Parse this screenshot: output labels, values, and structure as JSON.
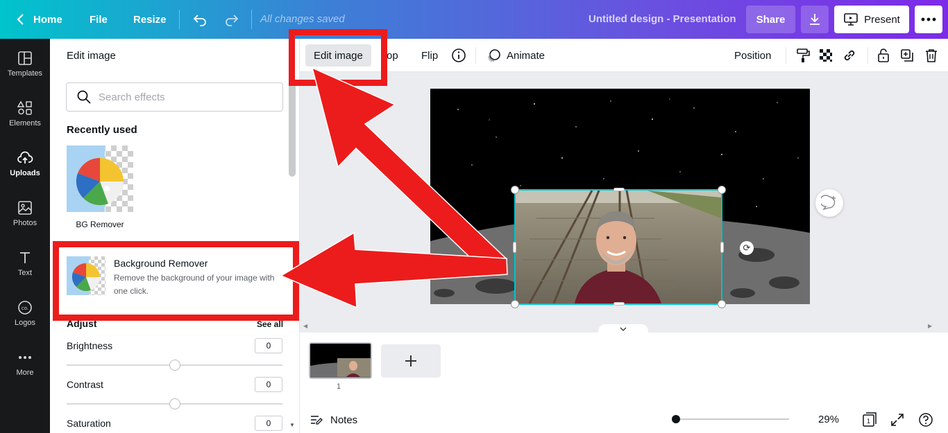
{
  "topbar": {
    "home": "Home",
    "file": "File",
    "resize": "Resize",
    "saved_status": "All changes saved",
    "doc_title": "Untitled design - Presentation",
    "share": "Share",
    "present": "Present"
  },
  "rail": {
    "items": [
      {
        "label": "Templates",
        "icon": "templates-icon"
      },
      {
        "label": "Elements",
        "icon": "elements-icon"
      },
      {
        "label": "Uploads",
        "icon": "uploads-icon"
      },
      {
        "label": "Photos",
        "icon": "photos-icon"
      },
      {
        "label": "Text",
        "icon": "text-icon"
      },
      {
        "label": "Logos",
        "icon": "logos-icon"
      },
      {
        "label": "More",
        "icon": "more-icon"
      }
    ]
  },
  "panel": {
    "title": "Edit image",
    "search_placeholder": "Search effects",
    "recently_used": "Recently used",
    "recent_item": "BG Remover",
    "effect_name": "Background Remover",
    "effect_desc": "Remove the background of your image with one click.",
    "adjust": "Adjust",
    "see_all": "See all",
    "sliders": [
      {
        "label": "Brightness",
        "value": "0"
      },
      {
        "label": "Contrast",
        "value": "0"
      },
      {
        "label": "Saturation",
        "value": "0"
      }
    ]
  },
  "ctxbar": {
    "edit_image": "Edit image",
    "crop": "rop",
    "flip": "Flip",
    "animate": "Animate",
    "position": "Position"
  },
  "pages": {
    "page_number": "1"
  },
  "footer": {
    "notes": "Notes",
    "zoom": "29%",
    "page_count": "1"
  },
  "colors": {
    "accent": "#7d2ae8",
    "selection": "#00c4cc",
    "annotation": "#ec1c1c"
  }
}
